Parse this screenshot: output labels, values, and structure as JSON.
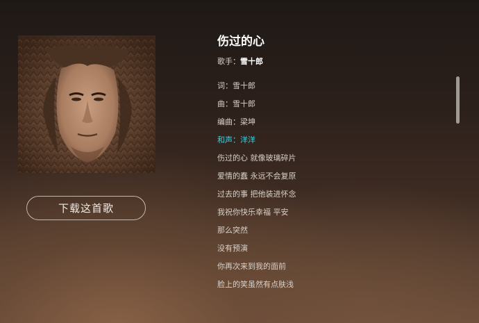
{
  "song": {
    "title": "伤过的心",
    "singer_label": "歌手：",
    "singer_name": "雪十郎"
  },
  "cover": {
    "alt": "album-cover"
  },
  "download_button": {
    "label": "下载这首歌"
  },
  "lyrics": [
    {
      "text": "词：雪十郎",
      "highlight": false
    },
    {
      "text": "曲：雪十郎",
      "highlight": false
    },
    {
      "text": "编曲：梁坤",
      "highlight": false
    },
    {
      "text": "和声：洋洋",
      "highlight": true
    },
    {
      "text": "伤过的心 就像玻璃碎片",
      "highlight": false
    },
    {
      "text": "爱情的蠢 永远不会复原",
      "highlight": false
    },
    {
      "text": "过去的事 把他装进怀念",
      "highlight": false
    },
    {
      "text": "我祝你快乐幸福 平安",
      "highlight": false
    },
    {
      "text": "那么突然",
      "highlight": false
    },
    {
      "text": "没有预演",
      "highlight": false
    },
    {
      "text": "你再次来到我的面前",
      "highlight": false
    },
    {
      "text": "脸上的笑虽然有点肤浅",
      "highlight": false
    }
  ],
  "colors": {
    "highlight": "#35d6e0",
    "title": "#ffffff",
    "text": "#d8d1ca"
  }
}
